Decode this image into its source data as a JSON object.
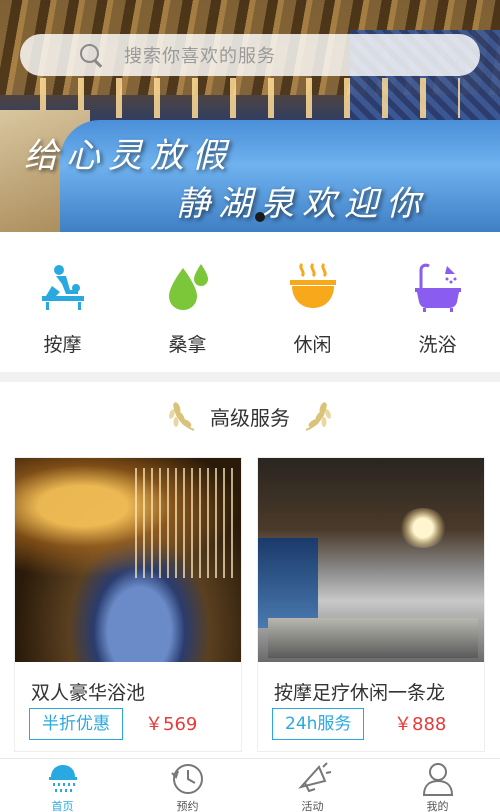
{
  "banner": {
    "search_placeholder": "搜索你喜欢的服务",
    "slogan_line1": "给心灵放假",
    "slogan_line2": "静湖泉欢迎你",
    "carousel_dots": 1
  },
  "categories": [
    {
      "label": "按摩",
      "icon": "massage-icon",
      "color": "#2aa9e0"
    },
    {
      "label": "桑拿",
      "icon": "water-drops-icon",
      "color": "#7cc63a"
    },
    {
      "label": "休闲",
      "icon": "hot-bowl-icon",
      "color": "#f7a81b"
    },
    {
      "label": "洗浴",
      "icon": "bathtub-icon",
      "color": "#8b5cf0"
    }
  ],
  "section": {
    "title": "高级服务"
  },
  "services": [
    {
      "name": "双人豪华浴池",
      "tag": "半折优惠",
      "price": "￥569"
    },
    {
      "name": "按摩足疗休闲一条龙",
      "tag": "24h服务",
      "price": "￥888"
    }
  ],
  "tabbar": [
    {
      "label": "首页",
      "icon": "home-shower-icon",
      "active": true
    },
    {
      "label": "预约",
      "icon": "clock-icon",
      "active": false
    },
    {
      "label": "活动",
      "icon": "megaphone-icon",
      "active": false
    },
    {
      "label": "我的",
      "icon": "user-icon",
      "active": false
    }
  ],
  "colors": {
    "accent": "#2aa9e0",
    "price": "#e83a3a",
    "laurel": "#d9c27a"
  }
}
